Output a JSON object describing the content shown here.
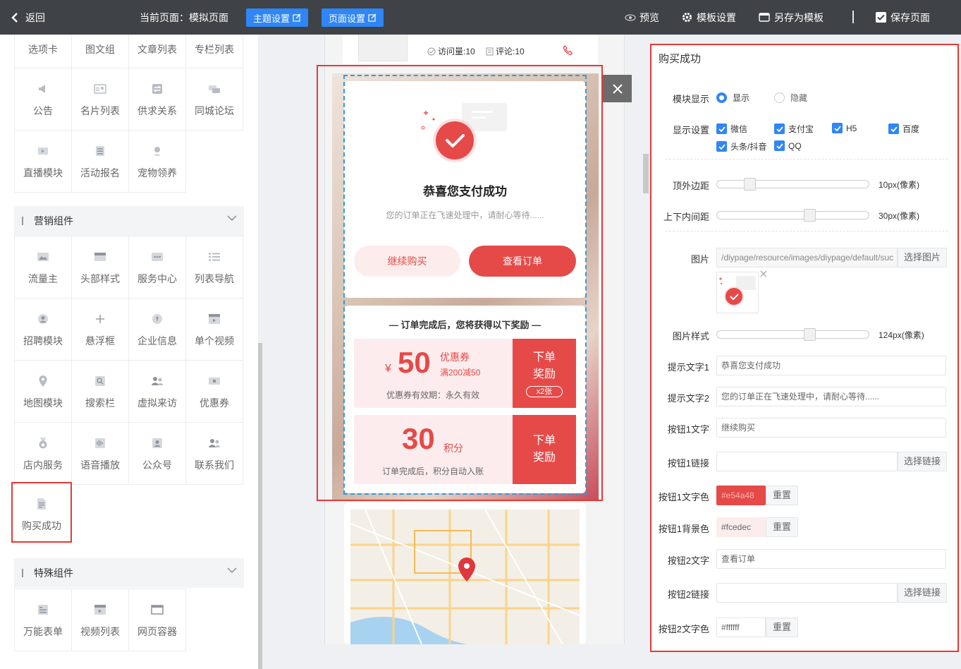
{
  "topbar": {
    "back": "返回",
    "current_page": "当前页面：模拟页面",
    "theme_btn": "主题设置",
    "page_btn": "页面设置",
    "preview": "预览",
    "template_settings": "模板设置",
    "save_as_template": "另存为模板",
    "save_page": "保存页面"
  },
  "left": {
    "row0": [
      "选项卡",
      "图文组",
      "文章列表",
      "专栏列表"
    ],
    "basic": [
      "公告",
      "名片列表",
      "供求关系",
      "同城论坛",
      "直播模块",
      "活动报名",
      "宠物领养"
    ],
    "marketing_title": "营销组件",
    "marketing": [
      "流量主",
      "头部样式",
      "服务中心",
      "列表导航",
      "招聘模块",
      "悬浮框",
      "企业信息",
      "单个视频",
      "地图模块",
      "搜索栏",
      "虚拟来访",
      "优惠券",
      "店内服务",
      "语音播放",
      "公众号",
      "联系我们",
      "购买成功"
    ],
    "special_title": "特殊组件",
    "special": [
      "万能表单",
      "视频列表",
      "网页容器"
    ]
  },
  "preview": {
    "visits": "访问量:10",
    "comments": "评论:10",
    "success_title": "恭喜您支付成功",
    "success_sub": "您的订单正在飞速处理中，请耐心等待......",
    "btn1": "继续购买",
    "btn2": "查看订单",
    "reward_title": "— 订单完成后，您将获得以下奖励 —",
    "coupon_symbol": "¥",
    "coupon_amount": "50",
    "coupon_label": "优惠券",
    "coupon_cond": "满200减50",
    "coupon_valid": "优惠券有效期：永久有效",
    "coupon_tag1": "下单",
    "coupon_tag2": "奖励",
    "coupon_count": "x2张",
    "points_amount": "30",
    "points_label": "积分",
    "points_note": "订单完成后，积分自动入账",
    "points_tag1": "下单",
    "points_tag2": "奖励"
  },
  "panel": {
    "title": "购买成功",
    "module_display_label": "模块显示",
    "display_show": "显示",
    "display_hide": "隐藏",
    "display_settings_label": "显示设置",
    "platforms": [
      "微信",
      "支付宝",
      "H5",
      "百度",
      "头条/抖音",
      "QQ"
    ],
    "top_margin_label": "顶外边距",
    "top_margin_value": "10px(像素)",
    "padding_label": "上下内间距",
    "padding_value": "30px(像素)",
    "image_label": "图片",
    "image_path": "/diypage/resource/images/diypage/default/suc",
    "choose_image": "选择图片",
    "image_style_label": "图片样式",
    "image_style_value": "124px(像素)",
    "tip1_label": "提示文字1",
    "tip1_value": "恭喜您支付成功",
    "tip2_label": "提示文字2",
    "tip2_value": "您的订单正在飞速处理中，请耐心等待......",
    "btn1_text_label": "按钮1文字",
    "btn1_text_value": "继续购买",
    "btn1_link_label": "按钮1链接",
    "choose_link": "选择链接",
    "btn1_color_label": "按钮1文字色",
    "btn1_color_value": "#e54a48",
    "reset": "重置",
    "btn1_bg_label": "按钮1背景色",
    "btn1_bg_value": "#fcedec",
    "btn2_text_label": "按钮2文字",
    "btn2_text_value": "查看订单",
    "btn2_link_label": "按钮2链接",
    "btn2_color_label": "按钮2文字色",
    "btn2_color_value": "#ffffff"
  },
  "colors": {
    "accent_red": "#e54a48",
    "accent_blue": "#2f86f6",
    "light_pink": "#fcedec"
  },
  "sliders": {
    "top_margin_fraction": 0.19,
    "padding_fraction": 0.62,
    "image_style_fraction": 0.62
  }
}
